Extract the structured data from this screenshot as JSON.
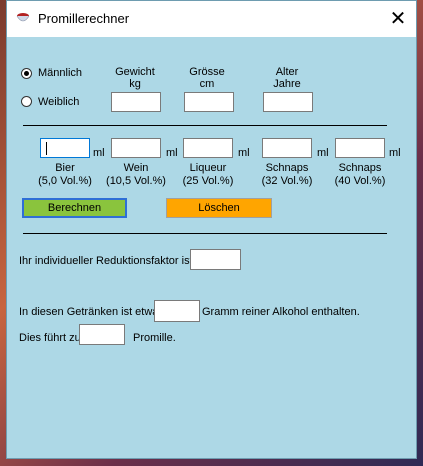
{
  "window": {
    "title": "Promillerechner",
    "close_glyph": "✕"
  },
  "gender": {
    "male_label": "Männlich",
    "female_label": "Weiblich",
    "selected": "Männlich"
  },
  "person": {
    "weight_label_1": "Gewicht",
    "weight_label_2": "kg",
    "height_label_1": "Grösse",
    "height_label_2": "cm",
    "age_label_1": "Alter",
    "age_label_2": "Jahre",
    "weight_value": "",
    "height_value": "",
    "age_value": ""
  },
  "drinks": {
    "unit": "ml",
    "items": [
      {
        "name": "Bier",
        "strength": "(5,0 Vol.%)",
        "value": ""
      },
      {
        "name": "Wein",
        "strength": "(10,5 Vol.%)",
        "value": ""
      },
      {
        "name": "Liqueur",
        "strength": "(25 Vol.%)",
        "value": ""
      },
      {
        "name": "Schnaps",
        "strength": "(32 Vol.%)",
        "value": ""
      },
      {
        "name": "Schnaps",
        "strength": "(40 Vol.%)",
        "value": ""
      }
    ]
  },
  "buttons": {
    "calc_label": "Berechnen",
    "delete_label": "Löschen",
    "calc_color": "#8ac43d",
    "delete_color": "#ffa500"
  },
  "results": {
    "reduction_label": "Ihr individueller Reduktionsfaktor ist",
    "reduction_value": "",
    "alcohol_prefix": "In diesen Getränken ist etwa",
    "alcohol_value": "",
    "alcohol_suffix": "Gramm reiner Alkohol enthalten.",
    "promille_prefix": "Dies führt zu",
    "promille_value": "",
    "promille_suffix": "Promille."
  },
  "icons": {
    "app": "alcohol-glass-icon",
    "close": "close-icon"
  },
  "colors": {
    "form_background": "#add8e6"
  }
}
